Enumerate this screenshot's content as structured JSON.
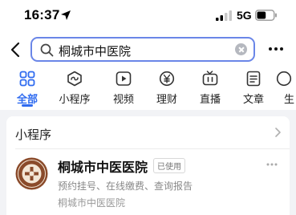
{
  "status_bar": {
    "time": "16:37",
    "network": "5G",
    "battery_level": 0.55
  },
  "search": {
    "query": "桐城市中医院"
  },
  "tabs": [
    {
      "label": "全部",
      "icon": "grid-icon",
      "active": true
    },
    {
      "label": "小程序",
      "icon": "mini-program-icon"
    },
    {
      "label": "视频",
      "icon": "video-icon"
    },
    {
      "label": "理财",
      "icon": "yen-icon"
    },
    {
      "label": "直播",
      "icon": "live-tv-icon"
    },
    {
      "label": "文章",
      "icon": "article-icon"
    },
    {
      "label": "生",
      "icon": "more-tab-icon"
    }
  ],
  "section": {
    "title": "小程序"
  },
  "result": {
    "name": "桐城市中医医院",
    "badge": "已使用",
    "description": "预约挂号、在线缴费、查询报告",
    "subtitle": "桐城市中医医院"
  },
  "colors": {
    "accent": "#2f6bf0",
    "search_border": "#6a86e8",
    "background": "#f2f3f6",
    "logo": "#8a4a2a"
  }
}
